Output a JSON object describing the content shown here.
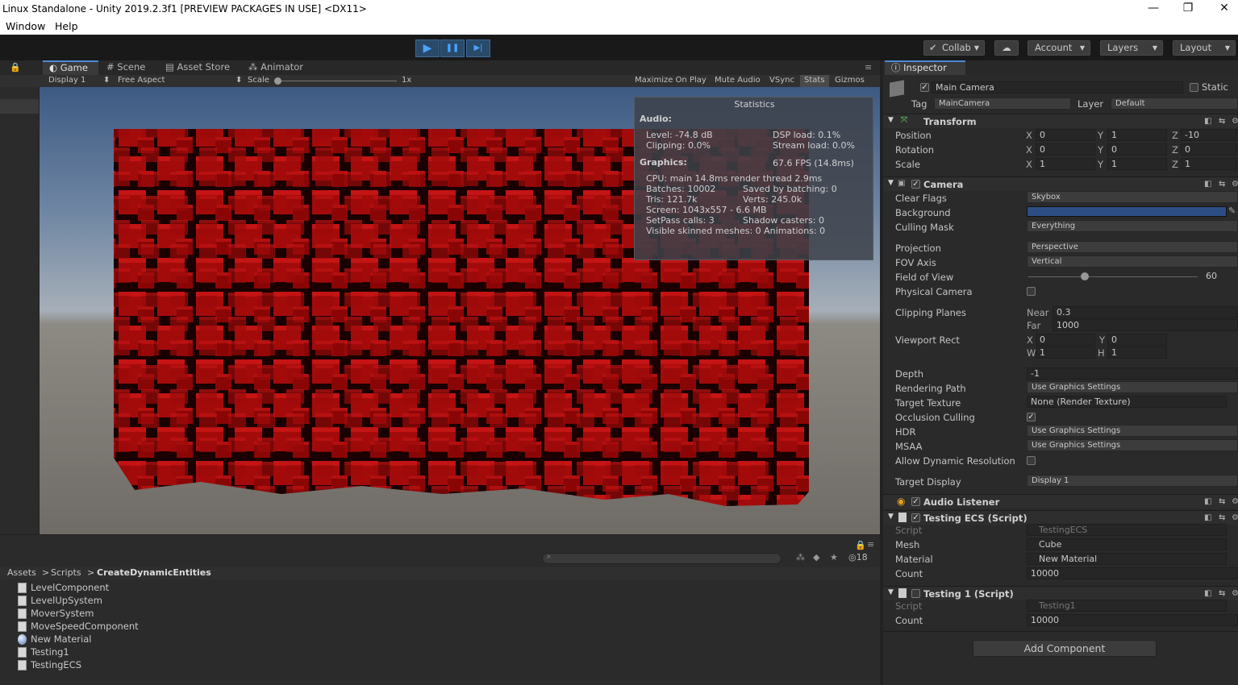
{
  "window": {
    "title": "Linux Standalone - Unity 2019.2.3f1 [PREVIEW PACKAGES IN USE] <DX11>",
    "minimize": "—",
    "restore": "❐",
    "close": "✕"
  },
  "menu": {
    "window": "Window",
    "help": "Help"
  },
  "toolbar": {
    "play": "▶",
    "pause": "❚❚",
    "step": "▶|",
    "collab": "Collab",
    "account": "Account",
    "layers": "Layers",
    "layout": "Layout"
  },
  "game_tabs": {
    "game": "Game",
    "scene": "Scene",
    "asset_store": "Asset Store",
    "animator": "Animator"
  },
  "game_bar": {
    "display": "Display 1",
    "aspect": "Free Aspect",
    "scale_label": "Scale",
    "scale_value": "1x",
    "maximize": "Maximize On Play",
    "mute": "Mute Audio",
    "vsync": "VSync",
    "stats": "Stats",
    "gizmos": "Gizmos"
  },
  "stats": {
    "header": "Statistics",
    "audio": "Audio:",
    "level": "Level: -74.8 dB",
    "dsp": "DSP load: 0.1%",
    "clipping": "Clipping: 0.0%",
    "stream": "Stream load: 0.0%",
    "graphics": "Graphics:",
    "fps": "67.6 FPS (14.8ms)",
    "cpu": "CPU: main 14.8ms  render thread 2.9ms",
    "batches": "Batches: 10002",
    "saved": "Saved by batching: 0",
    "tris": "Tris: 121.7k",
    "verts": "Verts: 245.0k",
    "screen": "Screen: 1043x557 - 6.6 MB",
    "setpass": "SetPass calls: 3",
    "shadow": "Shadow casters: 0",
    "skinned": "Visible skinned meshes: 0  Animations: 0"
  },
  "project": {
    "count": "18",
    "crumbs": [
      "Assets",
      ">",
      "Scripts",
      ">",
      "CreateDynamicEntities"
    ],
    "files": [
      {
        "name": "LevelComponent",
        "icon": "script-icon"
      },
      {
        "name": "LevelUpSystem",
        "icon": "script-icon"
      },
      {
        "name": "MoverSystem",
        "icon": "script-icon"
      },
      {
        "name": "MoveSpeedComponent",
        "icon": "script-icon"
      },
      {
        "name": "New Material",
        "icon": "material-icon"
      },
      {
        "name": "Testing1",
        "icon": "script-icon"
      },
      {
        "name": "TestingECS",
        "icon": "script-icon"
      }
    ]
  },
  "inspector": {
    "tab": "Inspector",
    "name": "Main Camera",
    "static": "Static",
    "tag_label": "Tag",
    "tag": "MainCamera",
    "layer_label": "Layer",
    "layer": "Default",
    "transform": {
      "title": "Transform",
      "position": "Position",
      "rotation": "Rotation",
      "scale": "Scale",
      "pos": [
        "0",
        "1",
        "-10"
      ],
      "rot": [
        "0",
        "0",
        "0"
      ],
      "scl": [
        "1",
        "1",
        "1"
      ],
      "x": "X",
      "y": "Y",
      "z": "Z"
    },
    "camera": {
      "title": "Camera",
      "clear_flags": "Clear Flags",
      "clear_flags_v": "Skybox",
      "background": "Background",
      "culling": "Culling Mask",
      "culling_v": "Everything",
      "projection": "Projection",
      "projection_v": "Perspective",
      "fov_axis": "FOV Axis",
      "fov_axis_v": "Vertical",
      "fov": "Field of View",
      "fov_v": "60",
      "physical": "Physical Camera",
      "clipping": "Clipping Planes",
      "near": "Near",
      "near_v": "0.3",
      "far": "Far",
      "far_v": "1000",
      "viewport": "Viewport Rect",
      "vx": "0",
      "vy": "0",
      "vw": "1",
      "vh": "1",
      "w": "W",
      "h": "H",
      "depth": "Depth",
      "depth_v": "-1",
      "rendering": "Rendering Path",
      "rendering_v": "Use Graphics Settings",
      "target_tex": "Target Texture",
      "target_tex_v": "None (Render Texture)",
      "occlusion": "Occlusion Culling",
      "hdr": "HDR",
      "hdr_v": "Use Graphics Settings",
      "msaa": "MSAA",
      "msaa_v": "Use Graphics Settings",
      "dyn_res": "Allow Dynamic Resolution",
      "target_display": "Target Display",
      "target_display_v": "Display 1",
      "bg_color": "#2d4d85"
    },
    "audio_listener": {
      "title": "Audio Listener"
    },
    "testing_ecs": {
      "title": "Testing ECS (Script)",
      "script": "Script",
      "script_v": "TestingECS",
      "mesh": "Mesh",
      "mesh_v": "Cube",
      "material": "Material",
      "material_v": "New Material",
      "count": "Count",
      "count_v": "10000"
    },
    "testing1": {
      "title": "Testing 1 (Script)",
      "script": "Script",
      "script_v": "Testing1",
      "count": "Count",
      "count_v": "10000"
    },
    "add_component": "Add Component"
  }
}
